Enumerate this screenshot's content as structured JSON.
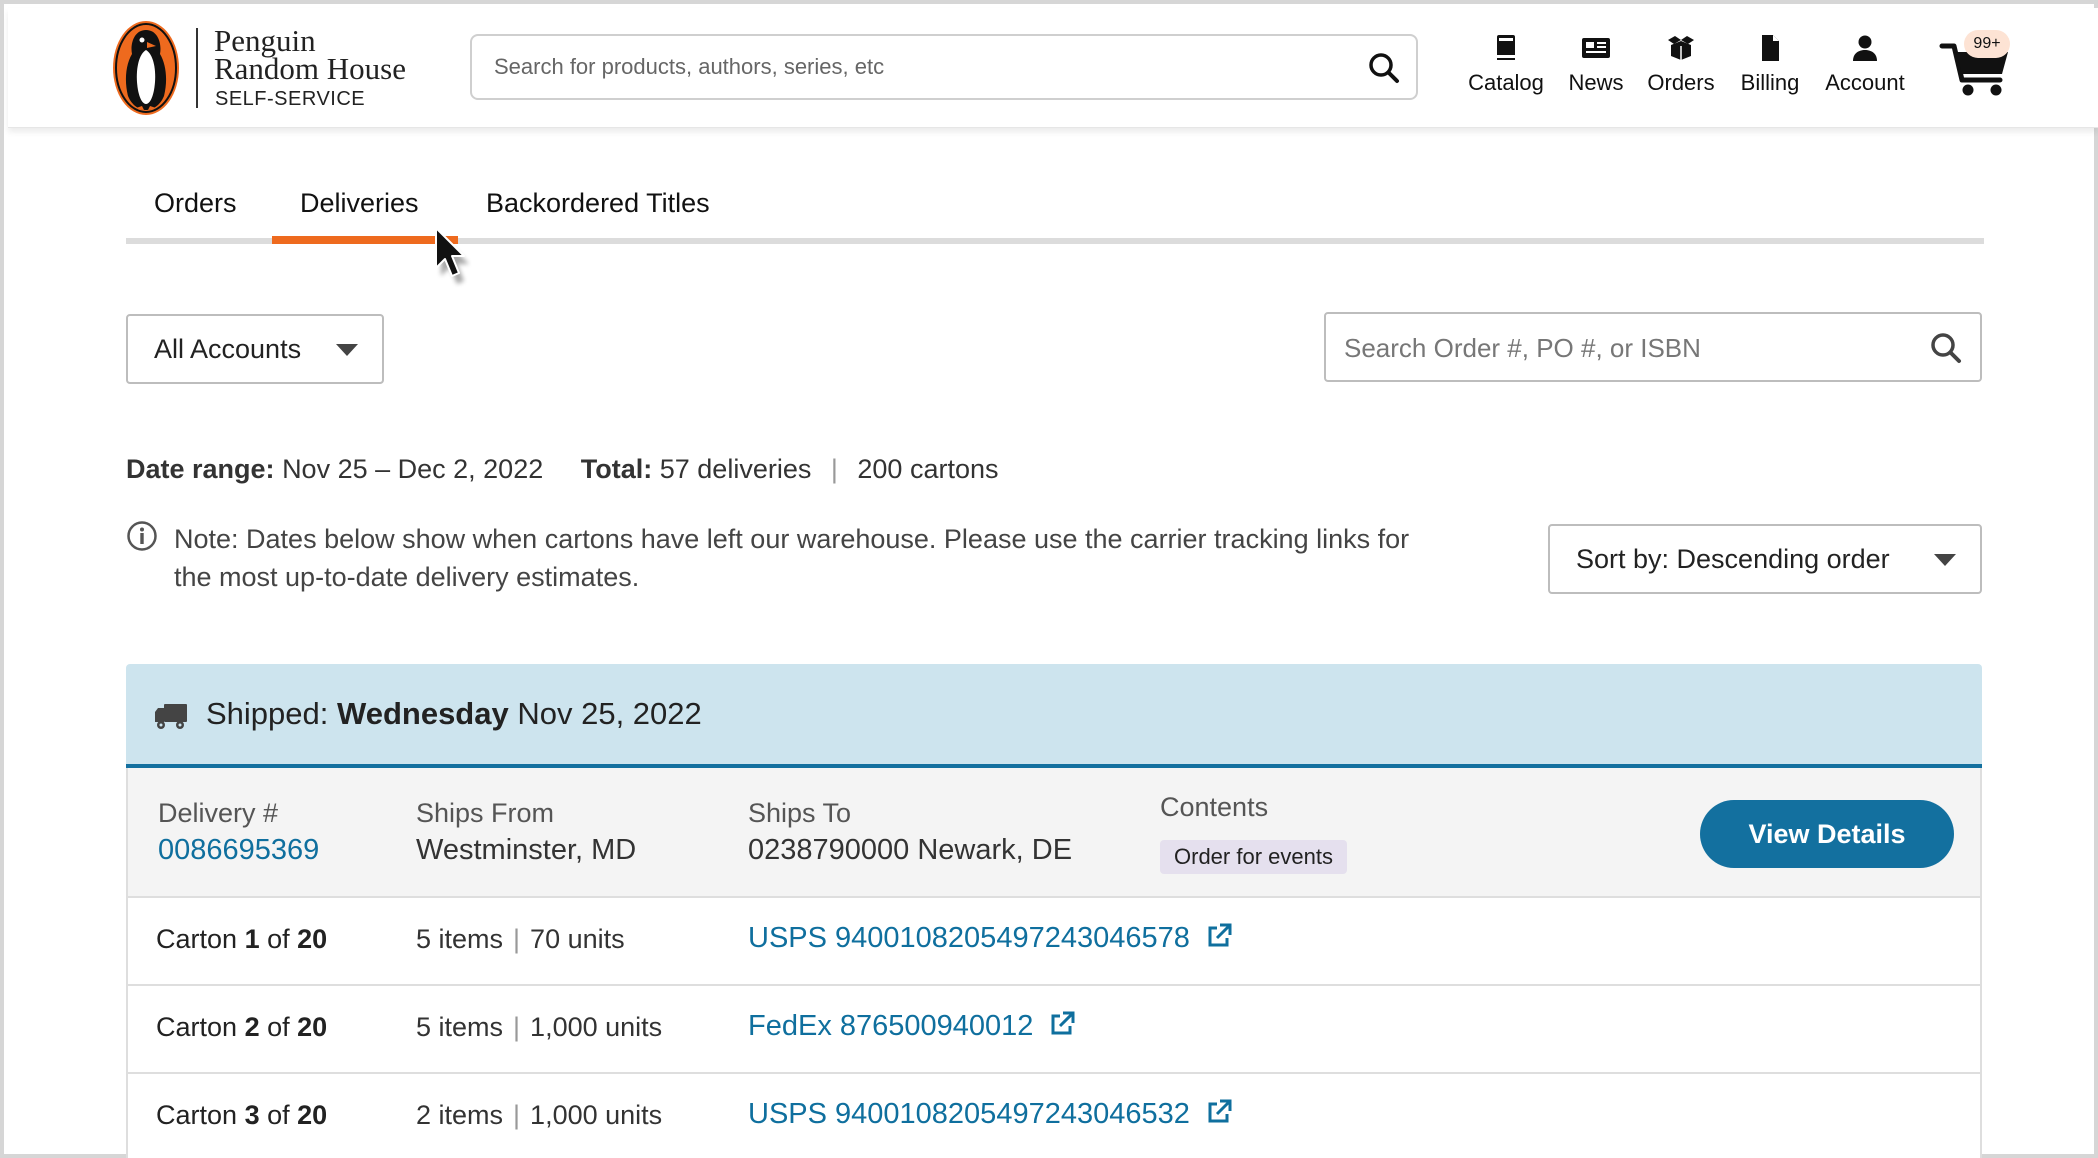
{
  "header": {
    "logo": {
      "line1": "Penguin",
      "line2": "Random House",
      "line3": "SELF-SERVICE"
    },
    "search": {
      "placeholder": "Search for products, authors, series, etc",
      "value": ""
    },
    "nav": [
      {
        "label": "Catalog",
        "icon": "book-icon"
      },
      {
        "label": "News",
        "icon": "newspaper-icon"
      },
      {
        "label": "Orders",
        "icon": "box-icon"
      },
      {
        "label": "Billing",
        "icon": "file-icon"
      },
      {
        "label": "Account",
        "icon": "user-icon"
      }
    ],
    "cart": {
      "badge": "99+",
      "icon": "cart-icon"
    }
  },
  "tabs": [
    {
      "label": "Orders",
      "active": false
    },
    {
      "label": "Deliveries",
      "active": true
    },
    {
      "label": "Backordered Titles",
      "active": false
    }
  ],
  "filters": {
    "account_select": "All Accounts",
    "search_placeholder": "Search Order #, PO #, or ISBN",
    "search_value": "",
    "sort_select": "Sort by: Descending order"
  },
  "summary": {
    "date_range_label": "Date range:",
    "date_range": "Nov 25 – Dec 2, 2022",
    "total_label": "Total:",
    "deliveries": "57 deliveries",
    "cartons": "200 cartons"
  },
  "note": "Note: Dates below show when cartons have left our warehouse. Please use the carrier tracking links for the most up-to-date delivery estimates.",
  "shipment": {
    "prefix": "Shipped:",
    "weekday": "Wednesday",
    "date": "Nov 25, 2022",
    "delivery_label": "Delivery #",
    "delivery_number": "0086695369",
    "ships_from_label": "Ships From",
    "ships_from": "Westminster, MD",
    "ships_to_label": "Ships To",
    "ships_to": "0238790000 Newark, DE",
    "contents_label": "Contents",
    "contents_tag": "Order for events",
    "view_details": "View Details",
    "cartons": [
      {
        "prefix": "Carton",
        "num": "1",
        "of": "of",
        "total": "20",
        "items": "5 items",
        "units": "70 units",
        "tracking": "USPS 9400108205497243046578"
      },
      {
        "prefix": "Carton",
        "num": "2",
        "of": "of",
        "total": "20",
        "items": "5 items",
        "units": "1,000 units",
        "tracking": "FedEx 876500940012"
      },
      {
        "prefix": "Carton",
        "num": "3",
        "of": "of",
        "total": "20",
        "items": "2 items",
        "units": "1,000 units",
        "tracking": "USPS 9400108205497243046532"
      }
    ]
  },
  "colors": {
    "accent_orange": "#ee6a1e",
    "brand_blue": "#13709f",
    "link_blue": "#0f6f9e",
    "shipment_header_bg": "#cde4ee"
  }
}
